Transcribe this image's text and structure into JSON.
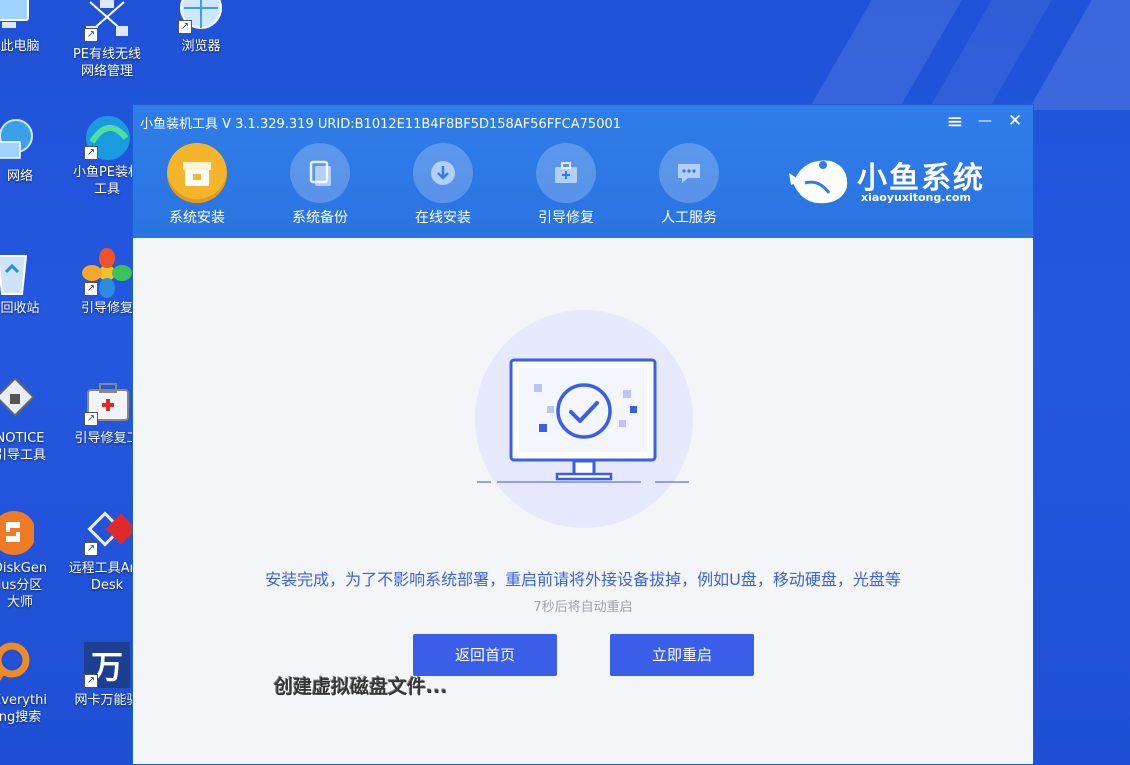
{
  "desktop": {
    "icons": [
      {
        "label": "此电脑"
      },
      {
        "label": "PE有线无线网络管理"
      },
      {
        "label": "浏览器"
      },
      {
        "label": "网络"
      },
      {
        "label": "小鱼PE装机工具"
      },
      {
        "label": "回收站"
      },
      {
        "label": "引导修复"
      },
      {
        "label": "NOTICE引导工具"
      },
      {
        "label": "引导修复工"
      },
      {
        "label": "DiskGenius分区大师"
      },
      {
        "label": "远程工具AnyDesk"
      },
      {
        "label": "Everything搜索"
      },
      {
        "label": "网卡万能驱"
      }
    ],
    "overlay_status": "创建虚拟磁盘文件..."
  },
  "window": {
    "title": "小鱼装机工具 V 3.1.329.319 URID:B1012E11B4F8BF5D158AF56FFCA75001",
    "controls": {
      "menu": "≡",
      "minimize": "—",
      "close": "✕"
    },
    "nav": [
      {
        "label": "系统安装",
        "active": true,
        "icon": "package-icon"
      },
      {
        "label": "系统备份",
        "active": false,
        "icon": "backup-icon"
      },
      {
        "label": "在线安装",
        "active": false,
        "icon": "download-icon"
      },
      {
        "label": "引导修复",
        "active": false,
        "icon": "toolbox-icon"
      },
      {
        "label": "人工服务",
        "active": false,
        "icon": "chat-icon"
      }
    ],
    "brand": {
      "name": "小鱼系统",
      "url": "xiaoyuxitong.com"
    }
  },
  "content": {
    "message": "安装完成，为了不影响系统部署，重启前请将外接设备拔掉，例如U盘，移动硬盘，光盘等",
    "countdown": "7秒后将自动重启",
    "buttons": {
      "home": "返回首页",
      "reboot": "立即重启"
    }
  },
  "colors": {
    "desktop_bg": "#2458df",
    "titlebar": "#2f7de8",
    "active_nav": "#f5b52b",
    "accent": "#3b5ee8",
    "message_text": "#3a63e6",
    "countdown_text": "#a0a4ab"
  }
}
